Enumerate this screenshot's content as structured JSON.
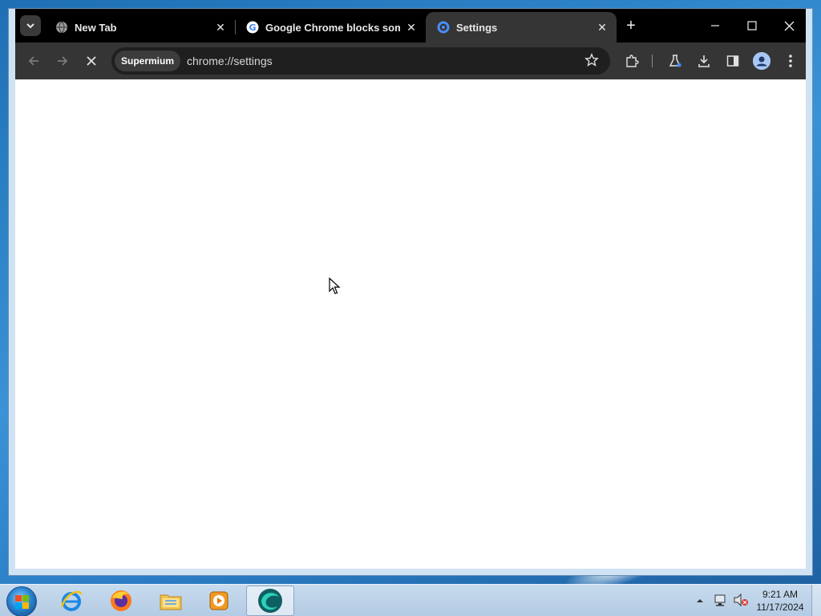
{
  "browser": {
    "tabs": [
      {
        "title": "New Tab",
        "favicon": "globe-icon"
      },
      {
        "title": "Google Chrome blocks some d",
        "favicon": "google-g-icon"
      },
      {
        "title": "Settings",
        "favicon": "settings-gear-icon",
        "active": true
      }
    ],
    "new_tab_symbol": "+",
    "address_chip": "Supermium",
    "url": "chrome://settings",
    "loading": true
  },
  "taskbar": {
    "pinned": [
      {
        "name": "internet-explorer-icon"
      },
      {
        "name": "firefox-icon"
      },
      {
        "name": "file-explorer-icon"
      },
      {
        "name": "media-player-icon"
      },
      {
        "name": "supermium-browser-icon",
        "active": true
      }
    ],
    "clock": {
      "time": "9:21 AM",
      "date": "11/17/2024"
    }
  },
  "colors": {
    "tabstrip": "#000000",
    "toolbar": "#353535",
    "omnibox": "#1f1f1f",
    "taskbar": "#c8dbee",
    "desktop": "#2a7cc4"
  }
}
